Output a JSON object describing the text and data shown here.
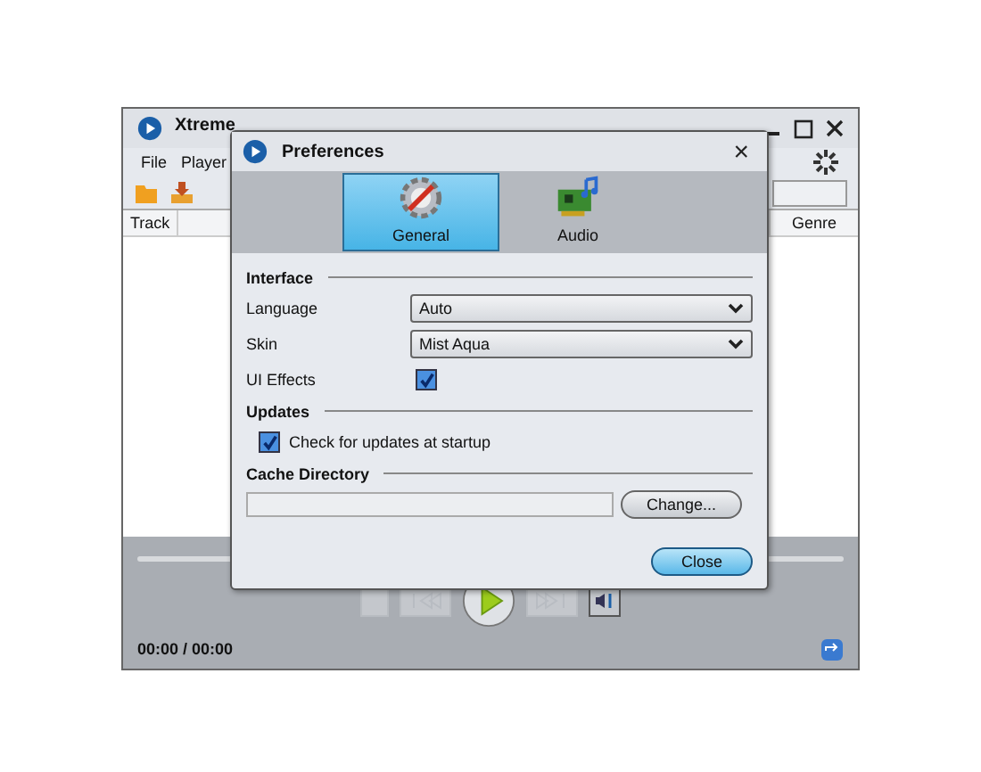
{
  "main_window": {
    "title": "Xtreme",
    "menu": [
      "File",
      "Player"
    ],
    "columns": [
      {
        "label": "Track"
      },
      {
        "label": "Genre"
      }
    ],
    "time": "00:00 / 00:00"
  },
  "dialog": {
    "title": "Preferences",
    "close": "×",
    "tabs": [
      {
        "label": "General",
        "kind": "general",
        "selected": true
      },
      {
        "label": "Audio",
        "kind": "audio",
        "selected": false
      }
    ],
    "interface": {
      "heading": "Interface",
      "language": {
        "label": "Language",
        "value": "Auto"
      },
      "skin": {
        "label": "Skin",
        "value": "Mist Aqua"
      },
      "ui_effects": {
        "label": "UI Effects",
        "checked": true
      }
    },
    "updates": {
      "heading": "Updates",
      "check_at_startup": {
        "label": "Check for updates at startup",
        "checked": true
      }
    },
    "cache": {
      "heading": "Cache Directory",
      "button": "Change..."
    },
    "close_button": "Close"
  }
}
